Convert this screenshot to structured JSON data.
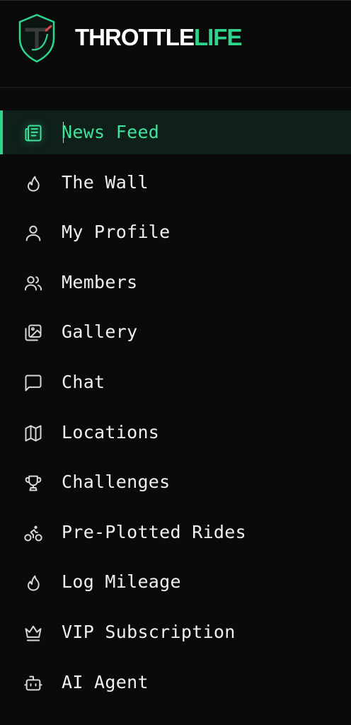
{
  "brand": {
    "name_primary": "THROTTLE",
    "name_accent": "LIFE",
    "logo_icon": "shield-logo-icon",
    "accent_color": "#2ed48c"
  },
  "nav": {
    "active_index": 0,
    "items": [
      {
        "label": "News Feed",
        "icon": "newspaper-icon"
      },
      {
        "label": "The Wall",
        "icon": "flame-icon"
      },
      {
        "label": "My Profile",
        "icon": "user-icon"
      },
      {
        "label": "Members",
        "icon": "users-icon"
      },
      {
        "label": "Gallery",
        "icon": "images-icon"
      },
      {
        "label": "Chat",
        "icon": "message-square-icon"
      },
      {
        "label": "Locations",
        "icon": "map-icon"
      },
      {
        "label": "Challenges",
        "icon": "trophy-icon"
      },
      {
        "label": "Pre-Plotted Rides",
        "icon": "bike-icon"
      },
      {
        "label": "Log Mileage",
        "icon": "flame-icon"
      },
      {
        "label": "VIP Subscription",
        "icon": "crown-icon"
      },
      {
        "label": "AI Agent",
        "icon": "bot-icon"
      }
    ]
  }
}
